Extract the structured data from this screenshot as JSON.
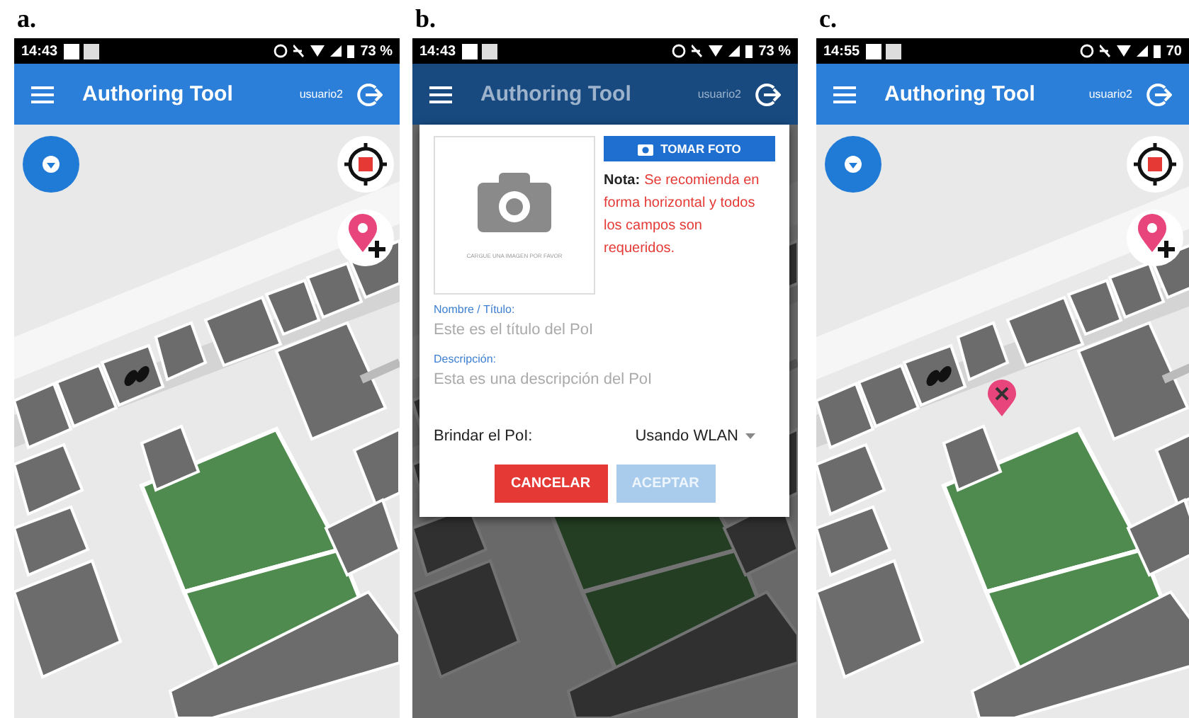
{
  "panels": [
    {
      "label": "a.",
      "status_bar": {
        "time": "14:43",
        "battery": "73 %"
      },
      "app_bar": {
        "title": "Authoring Tool",
        "user": "usuario2"
      },
      "dimmed": false,
      "markers": [
        {
          "kind": "user"
        }
      ]
    },
    {
      "label": "b.",
      "status_bar": {
        "time": "14:43",
        "battery": "73 %"
      },
      "app_bar": {
        "title": "Authoring Tool",
        "user": "usuario2"
      },
      "dimmed": true,
      "dialog": {
        "photo_hint": "CARGUE UNA IMAGEN POR FAVOR",
        "photo_button": "TOMAR FOTO",
        "note_label": "Nota:",
        "note_text": "Se recomienda en forma horizontal y todos los campos son requeridos.",
        "fields": [
          {
            "label": "Nombre / Título:",
            "placeholder": "Este es el título del PoI"
          },
          {
            "label": "Descripción:",
            "placeholder": "Esta es una descripción del PoI"
          }
        ],
        "select": {
          "label": "Brindar el PoI:",
          "value": "Usando WLAN"
        },
        "buttons": [
          {
            "label": "CANCELAR",
            "kind": "cancel",
            "disabled": false
          },
          {
            "label": "ACEPTAR",
            "kind": "accept",
            "disabled": true
          }
        ]
      }
    },
    {
      "label": "c.",
      "status_bar": {
        "time": "14:55",
        "battery": "70"
      },
      "app_bar": {
        "title": "Authoring Tool",
        "user": "usuario2"
      },
      "dimmed": false,
      "markers": [
        {
          "kind": "user"
        },
        {
          "kind": "poi"
        }
      ]
    }
  ]
}
